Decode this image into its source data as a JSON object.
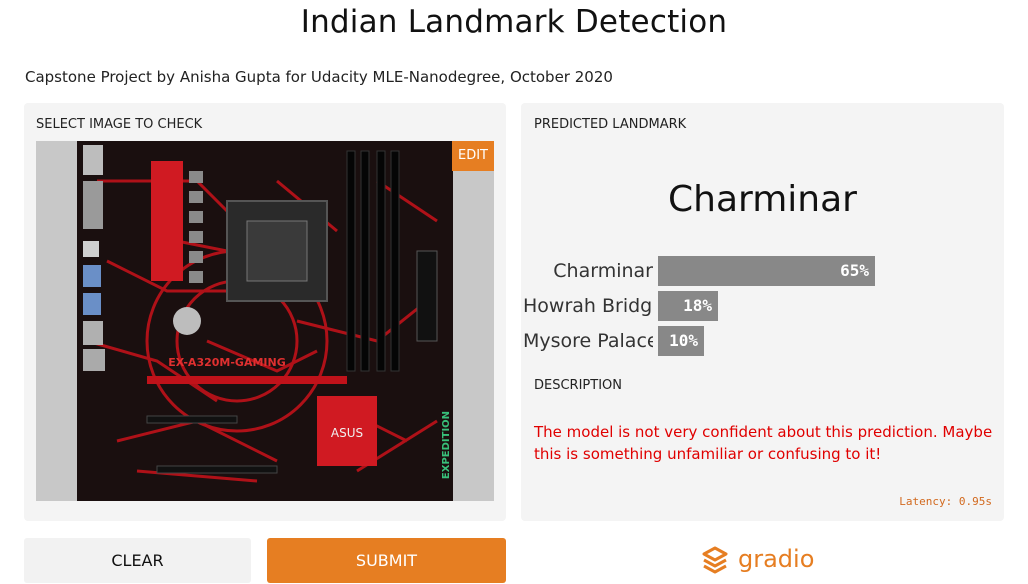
{
  "header": {
    "title": "Indian Landmark Detection",
    "subtitle": "Capstone Project by Anisha Gupta for Udacity MLE-Nanodegree, October 2020"
  },
  "input_panel": {
    "label": "SELECT IMAGE TO CHECK",
    "edit_label": "EDIT",
    "image_text": [
      "ASUS",
      "EX-A320M-GAMING",
      "EXPEDITION"
    ]
  },
  "output_panel": {
    "label": "PREDICTED LANDMARK",
    "top_prediction": "Charminar",
    "confidences": [
      {
        "name": "Charminar",
        "value": 0.65,
        "display": "65%"
      },
      {
        "name": "Howrah Bridge",
        "value": 0.18,
        "display": "18%"
      },
      {
        "name": "Mysore Palace",
        "value": 0.1,
        "display": "10%"
      }
    ],
    "description_label": "DESCRIPTION",
    "description": "The model is not very confident about this prediction. Maybe this is something unfamiliar or confusing to it!",
    "latency": "Latency: 0.95s"
  },
  "buttons": {
    "clear": "CLEAR",
    "submit": "SUBMIT"
  },
  "brand": {
    "name": "gradio",
    "accent": "#e67e22"
  }
}
